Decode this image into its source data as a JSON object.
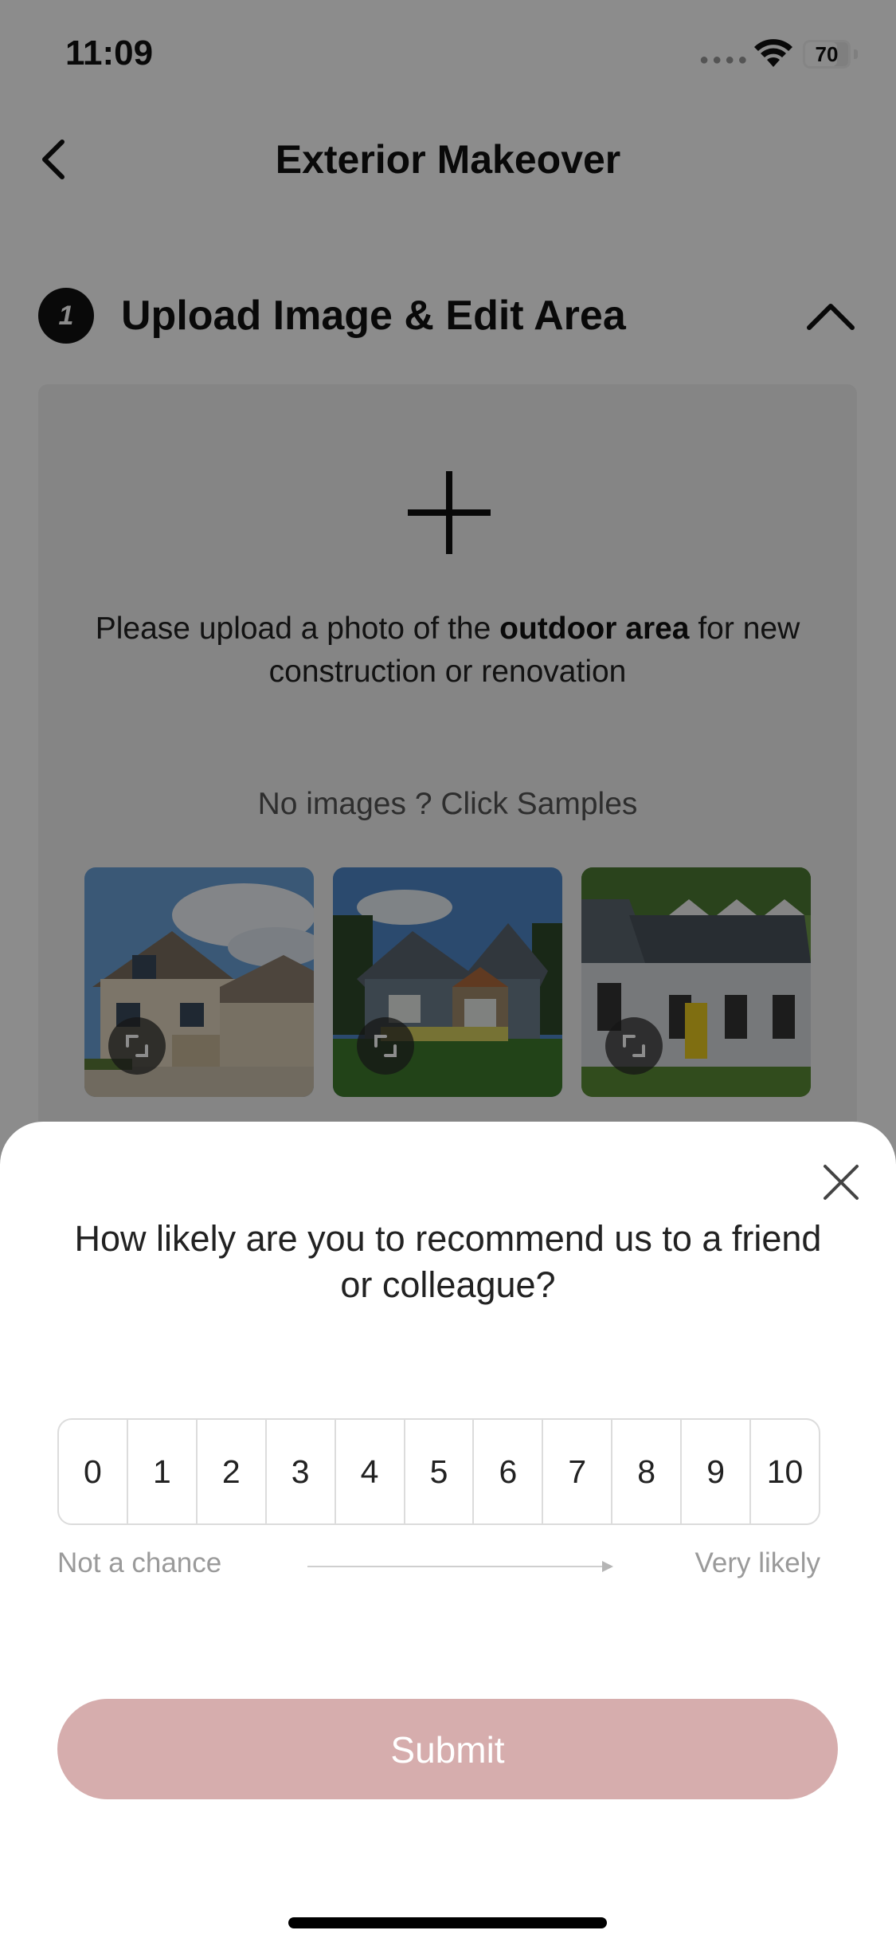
{
  "status_bar": {
    "time": "11:09",
    "battery": "70"
  },
  "nav": {
    "title": "Exterior Makeover"
  },
  "section": {
    "step_number": "1",
    "title": "Upload Image & Edit Area"
  },
  "upload": {
    "prompt_before": "Please upload a photo of the ",
    "prompt_bold": "outdoor area",
    "prompt_after": " for new construction or renovation",
    "samples_hint": "No images ? Click Samples"
  },
  "survey": {
    "question": "How likely are you to recommend us to a friend or colleague?",
    "scores": [
      "0",
      "1",
      "2",
      "3",
      "4",
      "5",
      "6",
      "7",
      "8",
      "9",
      "10"
    ],
    "low_label": "Not a chance",
    "high_label": "Very likely",
    "submit_label": "Submit"
  },
  "colors": {
    "submit_bg": "#d6adad",
    "overlay": "rgba(0,0,0,0.45)"
  }
}
